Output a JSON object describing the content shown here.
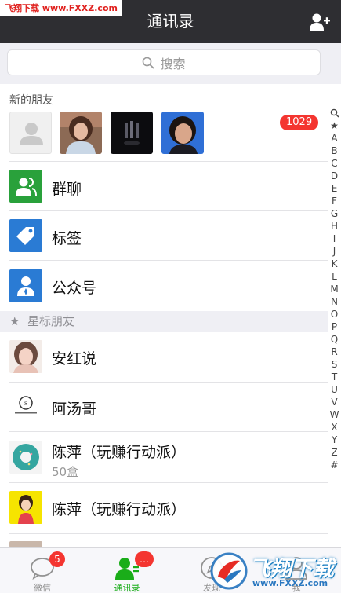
{
  "watermark": {
    "top_left": "飞翔下载 www.FXXZ.com",
    "logo_text": "飞翔下载",
    "logo_url": "www.FXXZ.com"
  },
  "header": {
    "title": "通讯录"
  },
  "search": {
    "placeholder": "搜索"
  },
  "new_friends": {
    "label": "新的朋友",
    "badge": "1029"
  },
  "rows": [
    {
      "label": "群聊",
      "icon": "group-chat-icon",
      "color": "#29a13b"
    },
    {
      "label": "标签",
      "icon": "tag-icon",
      "color": "#2a7bd4"
    },
    {
      "label": "公众号",
      "icon": "official-account-icon",
      "color": "#2a7bd4"
    }
  ],
  "starred_section": {
    "star": "★",
    "label": "星标朋友"
  },
  "contacts": [
    {
      "name": "安红说",
      "subtitle": ""
    },
    {
      "name": "阿汤哥",
      "subtitle": ""
    },
    {
      "name": "陈萍（玩赚行动派）",
      "subtitle": "50盒"
    },
    {
      "name": "陈萍（玩赚行动派）",
      "subtitle": ""
    }
  ],
  "index_letters": [
    "★",
    "A",
    "B",
    "C",
    "D",
    "E",
    "F",
    "G",
    "H",
    "I",
    "J",
    "K",
    "L",
    "M",
    "N",
    "O",
    "P",
    "Q",
    "R",
    "S",
    "T",
    "U",
    "V",
    "W",
    "X",
    "Y",
    "Z",
    "#"
  ],
  "tabs": [
    {
      "label": "微信",
      "badge": "5"
    },
    {
      "label": "通讯录",
      "badge": "…"
    },
    {
      "label": "发现",
      "badge": ""
    },
    {
      "label": "我",
      "badge": ""
    }
  ],
  "colors": {
    "accent_green": "#1aad19",
    "header_bg": "#2e2e32",
    "badge_red": "#f43530"
  }
}
